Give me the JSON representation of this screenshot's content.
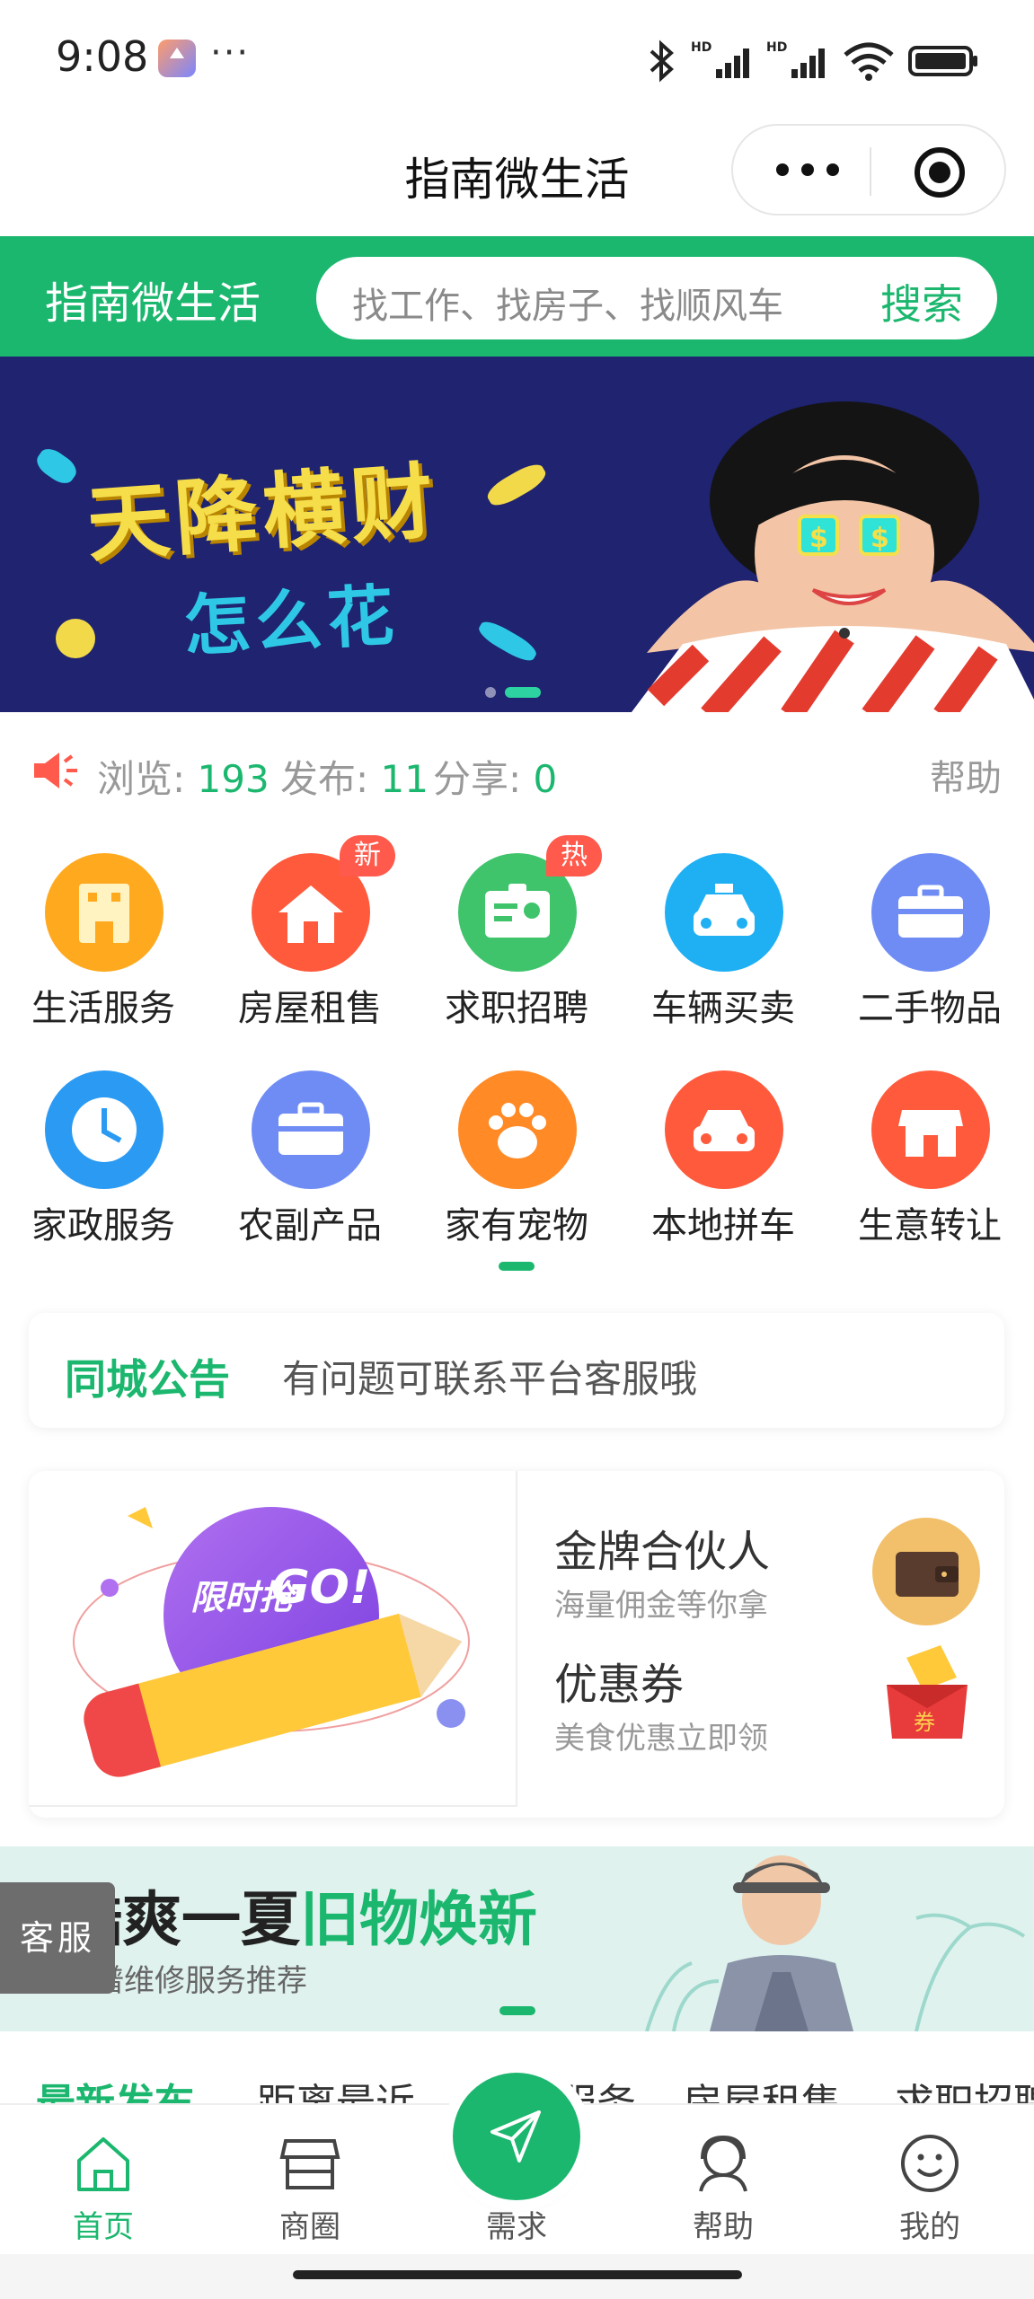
{
  "status_bar": {
    "time": "9:08",
    "more": "···"
  },
  "header": {
    "title": "指南微生活"
  },
  "search_bar": {
    "brand": "指南微生活",
    "placeholder": "找工作、找房子、找顺风车",
    "button": "搜索"
  },
  "banner": {
    "line1": "天降横财",
    "line2": "怎么花",
    "slide_count": 2,
    "active_slide": 2
  },
  "stats": {
    "views_label": "浏览:",
    "views": "193",
    "posts_label": "发布:",
    "posts": "11",
    "shares_label": "分享:",
    "shares": "0",
    "help": "帮助"
  },
  "categories": [
    {
      "label": "生活服务",
      "icon": "building-icon",
      "color": "#ffa91f"
    },
    {
      "label": "房屋租售",
      "icon": "house-icon",
      "color": "#ff5a3c",
      "badge": "新"
    },
    {
      "label": "求职招聘",
      "icon": "id-card-icon",
      "color": "#3fc46c",
      "badge": "热"
    },
    {
      "label": "车辆买卖",
      "icon": "taxi-icon",
      "color": "#1fb0f4"
    },
    {
      "label": "二手物品",
      "icon": "briefcase-icon",
      "color": "#6f8cf5"
    },
    {
      "label": "家政服务",
      "icon": "clock-icon",
      "color": "#2b9af3"
    },
    {
      "label": "农副产品",
      "icon": "briefcase-icon",
      "color": "#6f8cf5"
    },
    {
      "label": "家有宠物",
      "icon": "paw-icon",
      "color": "#ff8a26"
    },
    {
      "label": "本地拼车",
      "icon": "car-icon",
      "color": "#ff5a3c"
    },
    {
      "label": "生意转让",
      "icon": "shop-icon",
      "color": "#ff5a3c"
    }
  ],
  "notice": {
    "title": "同城公告",
    "text": "有问题可联系平台客服哦"
  },
  "promo": {
    "left_badge_1": "限时抢",
    "left_badge_2": "GO!",
    "items": [
      {
        "title": "金牌合伙人",
        "subtitle": "海量佣金等你拿",
        "icon": "wallet-icon"
      },
      {
        "title": "优惠券",
        "subtitle": "美食优惠立即领",
        "icon": "coupon-icon",
        "coupon_text": "券"
      }
    ]
  },
  "summer_banner": {
    "title_a": "酷爽一夏",
    "title_b": "旧物焕新",
    "subtitle": "靠谱维修服务推荐"
  },
  "customer_service": "客服",
  "filters": [
    "最新发布",
    "距离最近",
    "服务",
    "房屋租售",
    "求职招聘"
  ],
  "tabbar": [
    {
      "label": "首页",
      "icon": "home-icon",
      "active": true
    },
    {
      "label": "商圈",
      "icon": "store-icon",
      "active": false
    },
    {
      "label": "需求",
      "icon": "paper-plane-icon",
      "active": false
    },
    {
      "label": "帮助",
      "icon": "support-icon",
      "active": false
    },
    {
      "label": "我的",
      "icon": "smiley-icon",
      "active": false
    }
  ],
  "colors": {
    "brand": "#1bb76e",
    "banner_bg": "#1f2370",
    "accent_red": "#ff5a4c"
  }
}
